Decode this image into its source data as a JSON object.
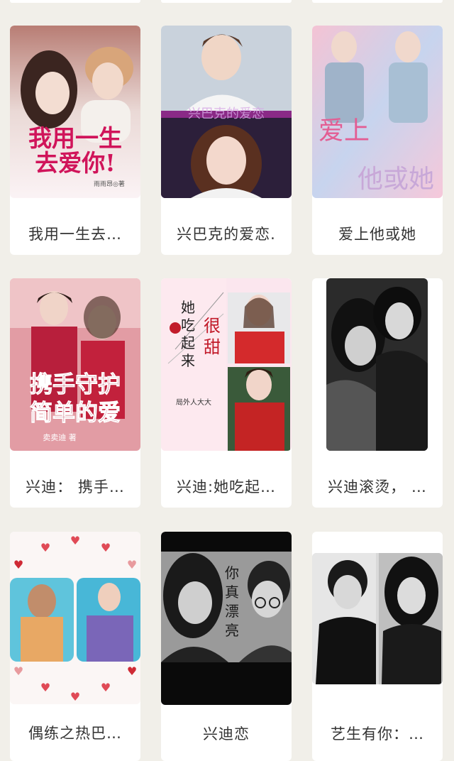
{
  "books": [
    {
      "title": "我用一生去…",
      "cover_text": "我用一生去爱你！",
      "cover_author": "雨雨昂◎著"
    },
    {
      "title": "兴巴克的爱恋.",
      "cover_text": "兴巴克的爱恋"
    },
    {
      "title": "爱上他或她",
      "cover_text": "爱上他或她"
    },
    {
      "title": "兴迪： 携手…",
      "cover_text": "携手守护简单的爱",
      "cover_author": "卖卖迪 著"
    },
    {
      "title": "兴迪:她吃起…",
      "cover_text_1": "她吃起来",
      "cover_text_2": "很甜",
      "cover_author": "局外人大大"
    },
    {
      "title": "兴迪滚烫， …"
    },
    {
      "title": "偶练之热巴…"
    },
    {
      "title": "兴迪恋",
      "cover_text": "你真漂亮"
    },
    {
      "title": "艺生有你：…"
    }
  ]
}
